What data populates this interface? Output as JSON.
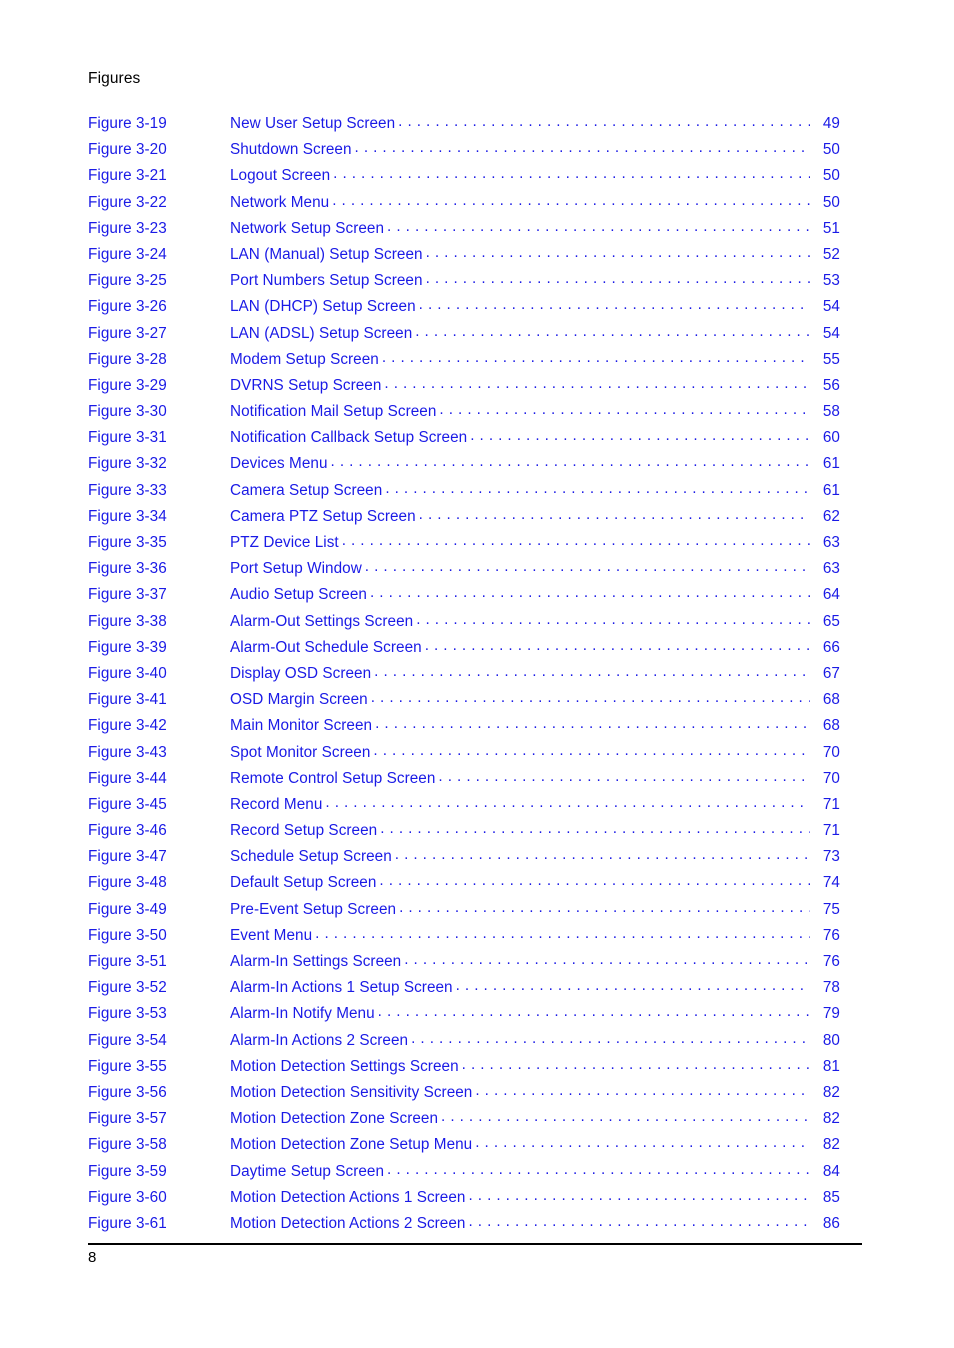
{
  "document": {
    "running_head": "Figures",
    "folio": "8",
    "link_color": "#1a1ae6",
    "text_color": "#000000"
  },
  "list_of_figures": {
    "entries": [
      {
        "label": "Figure 3-19",
        "title": "New User Setup Screen",
        "page": "49"
      },
      {
        "label": "Figure 3-20",
        "title": "Shutdown Screen",
        "page": "50"
      },
      {
        "label": "Figure 3-21",
        "title": "Logout Screen",
        "page": "50"
      },
      {
        "label": "Figure 3-22",
        "title": "Network Menu",
        "page": "50"
      },
      {
        "label": "Figure 3-23",
        "title": "Network Setup Screen",
        "page": "51"
      },
      {
        "label": "Figure 3-24",
        "title": "LAN (Manual) Setup Screen",
        "page": "52"
      },
      {
        "label": "Figure 3-25",
        "title": "Port Numbers Setup Screen",
        "page": "53"
      },
      {
        "label": "Figure 3-26",
        "title": "LAN (DHCP) Setup Screen",
        "page": "54"
      },
      {
        "label": "Figure 3-27",
        "title": "LAN (ADSL) Setup Screen",
        "page": "54"
      },
      {
        "label": "Figure 3-28",
        "title": "Modem Setup Screen",
        "page": "55"
      },
      {
        "label": "Figure 3-29",
        "title": "DVRNS Setup Screen",
        "page": "56"
      },
      {
        "label": "Figure 3-30",
        "title": "Notification Mail Setup Screen",
        "page": "58"
      },
      {
        "label": "Figure 3-31",
        "title": "Notification Callback Setup Screen",
        "page": "60"
      },
      {
        "label": "Figure 3-32",
        "title": "Devices Menu",
        "page": "61"
      },
      {
        "label": "Figure 3-33",
        "title": "Camera Setup Screen",
        "page": "61"
      },
      {
        "label": "Figure 3-34",
        "title": "Camera PTZ Setup Screen",
        "page": "62"
      },
      {
        "label": "Figure 3-35",
        "title": "PTZ Device List",
        "page": "63"
      },
      {
        "label": "Figure 3-36",
        "title": "Port Setup Window",
        "page": "63"
      },
      {
        "label": "Figure 3-37",
        "title": "Audio Setup Screen",
        "page": "64"
      },
      {
        "label": "Figure 3-38",
        "title": "Alarm-Out Settings Screen",
        "page": "65"
      },
      {
        "label": "Figure 3-39",
        "title": "Alarm-Out Schedule Screen",
        "page": "66"
      },
      {
        "label": "Figure 3-40",
        "title": "Display OSD Screen",
        "page": "67"
      },
      {
        "label": "Figure 3-41",
        "title": "OSD Margin Screen",
        "page": "68"
      },
      {
        "label": "Figure 3-42",
        "title": "Main Monitor Screen",
        "page": "68"
      },
      {
        "label": "Figure 3-43",
        "title": "Spot Monitor Screen",
        "page": "70"
      },
      {
        "label": "Figure 3-44",
        "title": "Remote Control Setup Screen",
        "page": "70"
      },
      {
        "label": "Figure 3-45",
        "title": "Record Menu",
        "page": "71"
      },
      {
        "label": "Figure 3-46",
        "title": "Record Setup Screen",
        "page": "71"
      },
      {
        "label": "Figure 3-47",
        "title": "Schedule Setup Screen",
        "page": "73"
      },
      {
        "label": "Figure 3-48",
        "title": "Default Setup Screen",
        "page": "74"
      },
      {
        "label": "Figure 3-49",
        "title": "Pre-Event Setup Screen",
        "page": "75"
      },
      {
        "label": "Figure 3-50",
        "title": "Event Menu",
        "page": "76"
      },
      {
        "label": "Figure 3-51",
        "title": "Alarm-In Settings Screen",
        "page": "76"
      },
      {
        "label": "Figure 3-52",
        "title": "Alarm-In Actions 1 Setup Screen",
        "page": "78"
      },
      {
        "label": "Figure 3-53",
        "title": "Alarm-In Notify Menu",
        "page": "79"
      },
      {
        "label": "Figure 3-54",
        "title": "Alarm-In Actions 2 Screen",
        "page": "80"
      },
      {
        "label": "Figure 3-55",
        "title": "Motion Detection Settings Screen",
        "page": "81"
      },
      {
        "label": "Figure 3-56",
        "title": "Motion Detection Sensitivity Screen",
        "page": "82"
      },
      {
        "label": "Figure 3-57",
        "title": "Motion Detection Zone Screen",
        "page": "82"
      },
      {
        "label": "Figure 3-58",
        "title": "Motion Detection Zone Setup Menu",
        "page": "82"
      },
      {
        "label": "Figure 3-59",
        "title": "Daytime Setup Screen",
        "page": "84"
      },
      {
        "label": "Figure 3-60",
        "title": "Motion Detection Actions 1 Screen",
        "page": "85"
      },
      {
        "label": "Figure 3-61",
        "title": "Motion Detection Actions 2 Screen",
        "page": "86"
      }
    ]
  }
}
